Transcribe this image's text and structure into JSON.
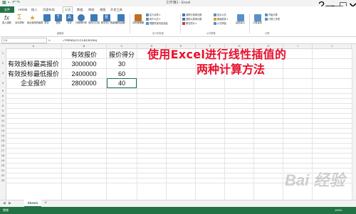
{
  "window": {
    "title": "工作簿1 - Excel",
    "controls": [
      "?",
      "▭",
      "—",
      "□",
      "✕"
    ]
  },
  "tabs": [
    "文件",
    "HOME",
    "插入",
    "页面布局",
    "公式",
    "数据",
    "审阅",
    "视图",
    "开发工具"
  ],
  "active_tab": "公式",
  "ribbon": {
    "buttons": [
      {
        "label": "插入函数",
        "icon": "fx-icon",
        "color": "#555555"
      },
      {
        "label": "自动求和",
        "icon": "sigma-icon",
        "color": "#d98c26"
      },
      {
        "label": "最近使用的函数",
        "icon": "star-icon",
        "color": "#d9a526"
      },
      {
        "label": "财务",
        "icon": "book-icon",
        "color": "#3d7ab8"
      },
      {
        "label": "逻辑",
        "icon": "question-icon",
        "color": "#3d7ab8"
      },
      {
        "label": "文本",
        "icon": "text-icon",
        "color": "#3d7ab8"
      },
      {
        "label": "日期和时间",
        "icon": "clock-icon",
        "color": "#3d7ab8"
      },
      {
        "label": "查找与引用",
        "icon": "search-icon",
        "color": "#3d7ab8"
      },
      {
        "label": "数学和三角函数",
        "icon": "theta-icon",
        "color": "#3d7ab8"
      },
      {
        "label": "其他函数",
        "icon": "more-icon",
        "color": "#3d7ab8"
      },
      {
        "label": "名称管理器",
        "icon": "tag-icon",
        "color": "#c07020"
      }
    ],
    "name_cmds": [
      "定义名称 ▾",
      "用于公式 ▾",
      "根据所选内容创建"
    ],
    "audit_cmds": [
      "追踪引用单元格",
      "追踪从属单元格",
      "移去箭头 ▾"
    ],
    "audit_cmds2": [
      "显示公式",
      "错误检查 ▾",
      "公式求值"
    ],
    "watch": "监视窗口",
    "calc": "计算选项",
    "calc_cmds": [
      "开始计算",
      "计算工作表"
    ],
    "groups": [
      "函数库",
      "定义的名称",
      "公式审核",
      "计算"
    ]
  },
  "formula_bar": {
    "name_box": "C4",
    "fx": "fx",
    "formula": "=TREND(C2:C3,B2:B3,B4)"
  },
  "columns": [
    "A",
    "B",
    "C",
    "D",
    "E",
    "F",
    "G",
    "H",
    "I",
    "J"
  ],
  "rows": [
    "1",
    "2",
    "3",
    "4",
    "5",
    "6",
    "7",
    "8",
    "9",
    "10",
    "11",
    "12",
    "13",
    "14",
    "15",
    "16",
    "17",
    "18",
    "19",
    "20",
    "21",
    "22",
    "23"
  ],
  "cells": {
    "B1": "有效报价",
    "C1": "报价得分",
    "A2": "有效投标最高报价",
    "B2": "3000000",
    "C2": "30",
    "A3": "有效投标最低报价",
    "B3": "2400000",
    "C3": "60",
    "A4": "企业报价",
    "B4": "2800000",
    "C4": "40"
  },
  "overlay": {
    "line1": "使用Excel进行线性插值的",
    "line2": "两种计算方法",
    "color": "#e8112d"
  },
  "sheet": {
    "tab": "Sheet1",
    "add": "+"
  },
  "status": {
    "ready": "就绪",
    "zoom": "100%"
  },
  "watermark": "Bai 经验"
}
